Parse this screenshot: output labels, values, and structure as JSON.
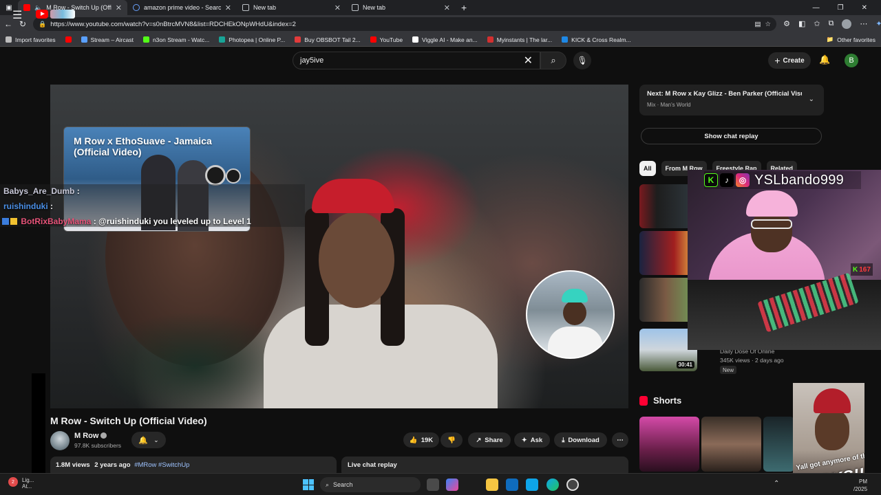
{
  "browser": {
    "tabs": [
      {
        "title": "M Row - Switch Up (Official",
        "icon": "youtube-icon",
        "active": true
      },
      {
        "title": "amazon prime video - Search",
        "icon": "bing-icon",
        "active": false
      },
      {
        "title": "New tab",
        "icon": "page-icon",
        "active": false
      },
      {
        "title": "New tab",
        "icon": "page-icon",
        "active": false
      }
    ],
    "new_tab": "+",
    "url": "https://www.youtube.com/watch?v=s0nBtrcMVN8&list=RDCHEkONpWHdU&index=2",
    "bookmarks": [
      {
        "label": "Import favorites",
        "color": "#bdbdbd"
      },
      {
        "label": "",
        "color": "#ff0000"
      },
      {
        "label": "Stream – Aircast",
        "color": "#5aa0ff"
      },
      {
        "label": "n3on Stream - Watc...",
        "color": "#53fc18"
      },
      {
        "label": "Photopea | Online P...",
        "color": "#18a497"
      },
      {
        "label": "Buy OBSBOT Tail 2...",
        "color": "#e23b3b"
      },
      {
        "label": "YouTube",
        "color": "#ff0000"
      },
      {
        "label": "Viggle AI - Make an...",
        "color": "#ffffff"
      },
      {
        "label": "Myinstants | The lar...",
        "color": "#d32f2f"
      },
      {
        "label": "KICK & Cross Realm...",
        "color": "#1e88e5"
      }
    ],
    "other_favorites": "Other favorites"
  },
  "youtube": {
    "search_value": "jay5ive",
    "create_label": "Create",
    "avatar_letter": "B"
  },
  "player": {
    "endcard_title": "M Row x EthoSuave - Jamaica (Official Video)"
  },
  "chat": {
    "lines": [
      {
        "user": "Babys_Are_Dumb",
        "msg": " :"
      },
      {
        "user": "ruishinduki",
        "msg": " :"
      },
      {
        "user": "BotRixBabyMama",
        "msg": " : @ruishinduki you leveled up to Level 1"
      }
    ]
  },
  "video": {
    "title": "M Row - Switch Up (Official Video)",
    "channel": "M Row",
    "subscribers": "97.8K subscribers",
    "likes": "19K",
    "share": "Share",
    "ask": "Ask",
    "download": "Download",
    "views": "1.8M views",
    "age": "2 years ago",
    "tags": "#MRow #SwitchUp",
    "live_chat_replay": "Live chat replay"
  },
  "sidebar": {
    "next_label": "Next:",
    "next_title": "M Row x Kay Glizz - Ben Parker (Official Visua...",
    "next_sub": "Mix · Man's World",
    "show_chat_replay": "Show chat replay",
    "chips": [
      "All",
      "From M Row",
      "Freestyle Rap",
      "Related"
    ],
    "rec": {
      "duration": "30:41",
      "channel": "Daily Dose Of Online",
      "meta": "345K views · 2 days ago",
      "badge": "New"
    },
    "shorts_label": "Shorts"
  },
  "overlay": {
    "handle": "YSLbando999",
    "kick_count": "167",
    "meme_caption1": "Yall got anymore of them",
    "meme_caption2": "KICKS!!!"
  },
  "taskbar": {
    "weather_line1": "Lig...",
    "weather_line2": "At...",
    "search_placeholder": "Search",
    "time": "PM",
    "date": "/2025"
  }
}
